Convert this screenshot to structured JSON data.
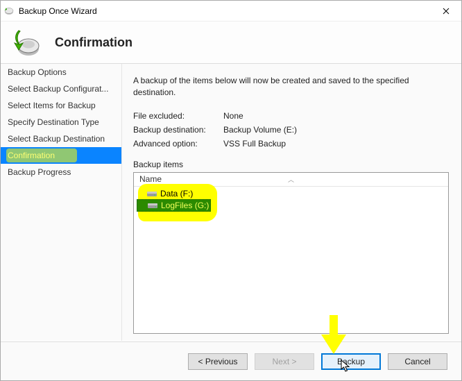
{
  "window": {
    "title": "Backup Once Wizard"
  },
  "header": {
    "title": "Confirmation"
  },
  "sidebar": {
    "steps": [
      "Backup Options",
      "Select Backup Configurat...",
      "Select Items for Backup",
      "Specify Destination Type",
      "Select Backup Destination",
      "Confirmation",
      "Backup Progress"
    ],
    "active_index": 5
  },
  "content": {
    "description": "A backup of the items below will now be created and saved to the specified destination.",
    "file_excluded_label": "File excluded:",
    "file_excluded_value": "None",
    "dest_label": "Backup destination:",
    "dest_value": "Backup Volume (E:)",
    "adv_label": "Advanced option:",
    "adv_value": "VSS Full Backup",
    "items_label": "Backup items",
    "grid": {
      "column": "Name",
      "rows": [
        "Data (F:)",
        "LogFiles (G:)"
      ],
      "selected_index": 1
    }
  },
  "footer": {
    "previous": "< Previous",
    "next": "Next >",
    "backup": "Backup",
    "cancel": "Cancel"
  }
}
